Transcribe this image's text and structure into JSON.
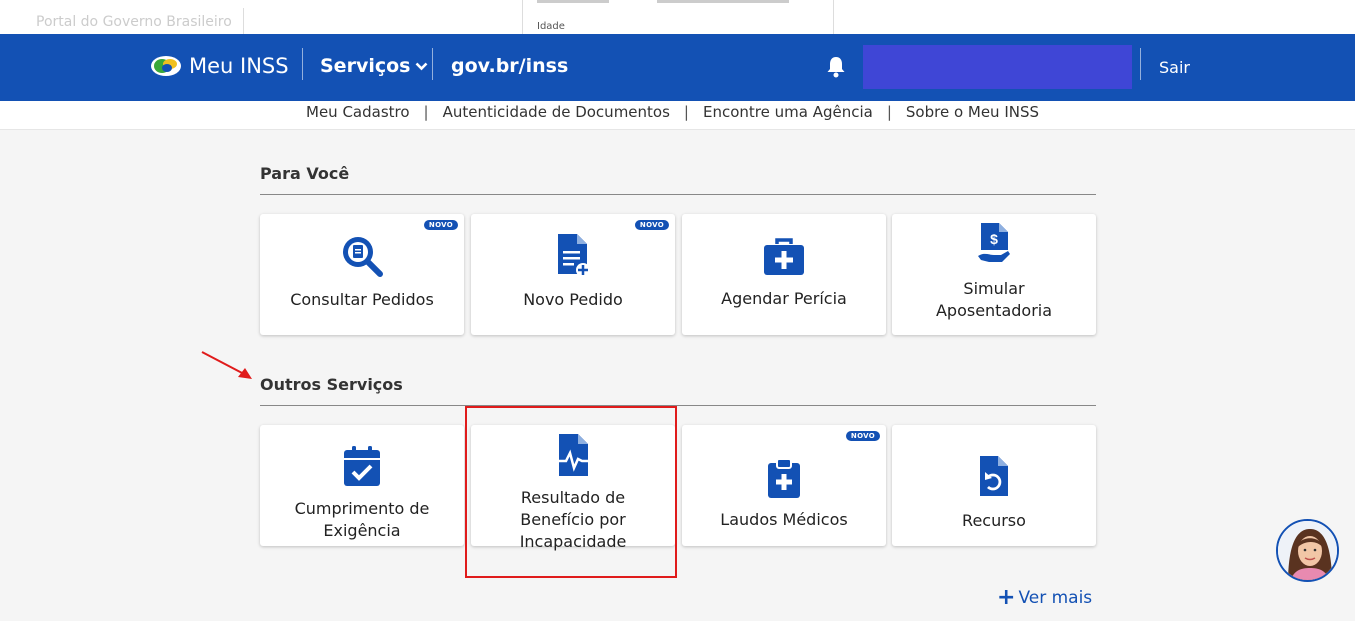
{
  "gov_strip": {
    "text": "Portal do Governo Brasileiro"
  },
  "popover": {
    "idade_label": "Idade"
  },
  "header": {
    "brand": "Meu INSS",
    "servicos": "Serviços",
    "govbr": "gov.br/inss",
    "sair": "Sair"
  },
  "subnav": {
    "items": [
      "Meu Cadastro",
      "Autenticidade de Documentos",
      "Encontre uma Agência",
      "Sobre o Meu INSS"
    ],
    "separator": "|"
  },
  "sections": {
    "para_voce": {
      "title": "Para Você",
      "cards": [
        {
          "label": "Consultar Pedidos",
          "badge": "NOVO",
          "icon": "search-document-icon"
        },
        {
          "label": "Novo Pedido",
          "badge": "NOVO",
          "icon": "document-add-icon"
        },
        {
          "label": "Agendar Perícia",
          "icon": "medical-kit-icon"
        },
        {
          "label_l1": "Simular",
          "label_l2": "Aposentadoria",
          "icon": "document-money-icon"
        }
      ]
    },
    "outros": {
      "title": "Outros Serviços",
      "cards": [
        {
          "label_l1": "Cumprimento de",
          "label_l2": "Exigência",
          "icon": "calendar-check-icon"
        },
        {
          "label_l1": "Resultado de",
          "label_l2": "Benefício por",
          "label_l3": "Incapacidade",
          "icon": "document-pulse-icon"
        },
        {
          "label": "Laudos Médicos",
          "badge": "NOVO",
          "icon": "clipboard-medical-icon"
        },
        {
          "label": "Recurso",
          "icon": "document-undo-icon"
        }
      ]
    }
  },
  "ver_mais": {
    "plus": "+",
    "label": "Ver mais"
  },
  "colors": {
    "brand_blue": "#1351b4",
    "highlight_red": "#e01b1b",
    "user_box": "#3f46d6"
  }
}
